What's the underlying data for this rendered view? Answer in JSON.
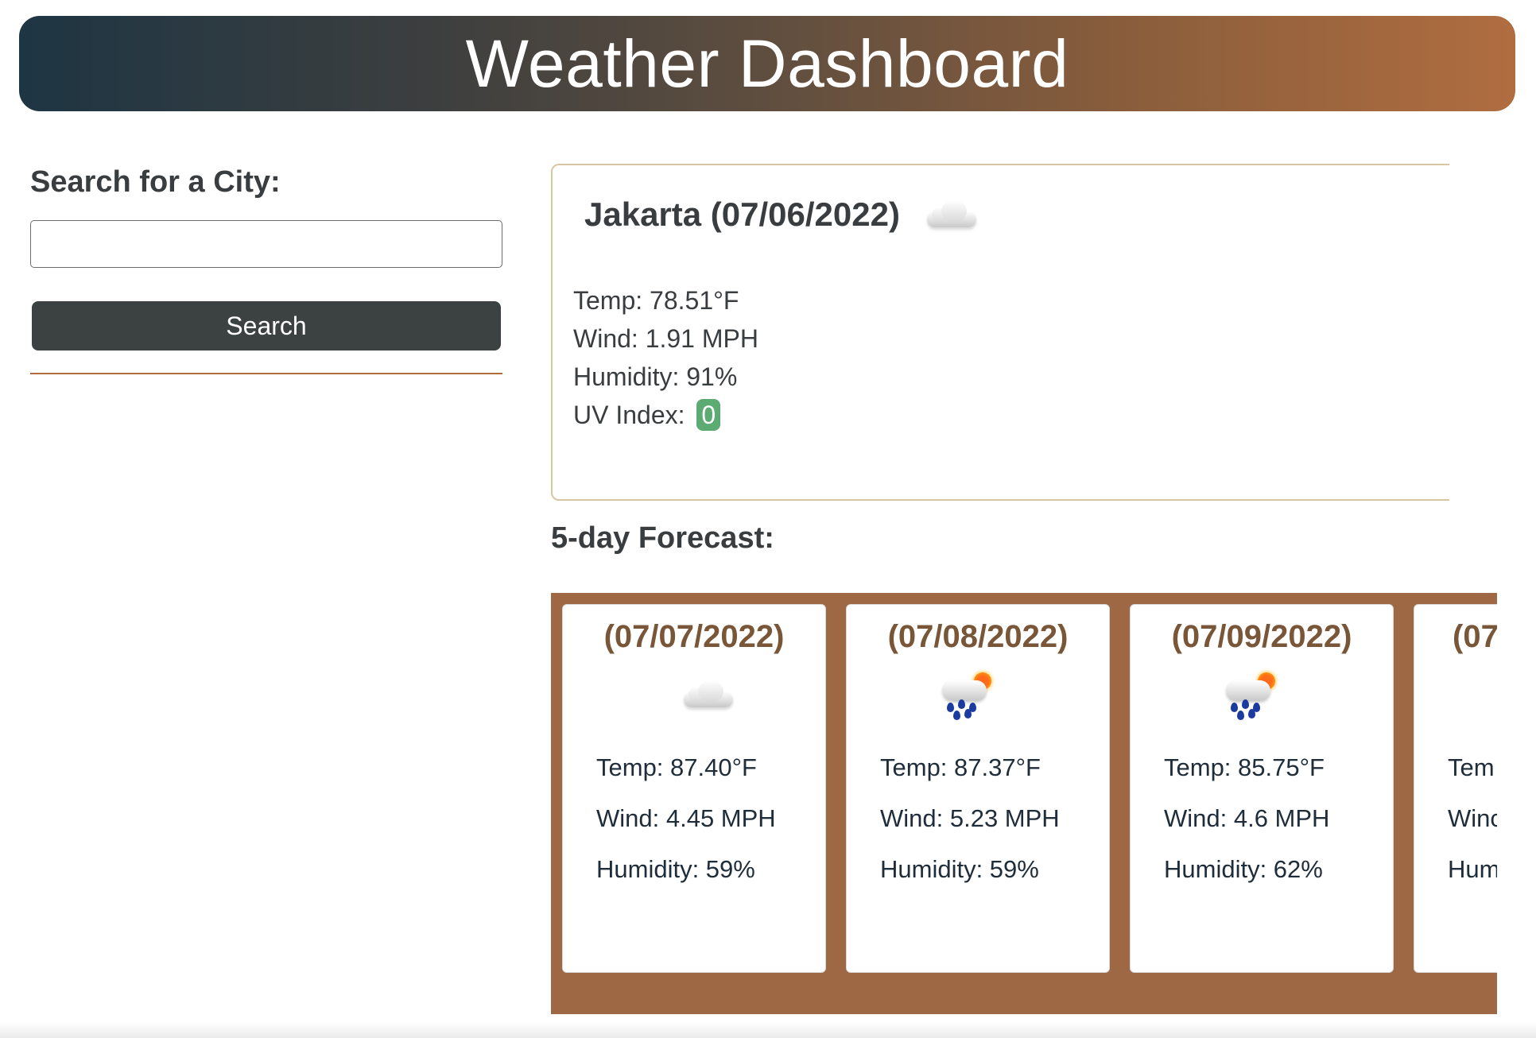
{
  "header": {
    "title": "Weather Dashboard"
  },
  "sidebar": {
    "search_label": "Search for a City:",
    "search_value": "",
    "search_placeholder": "",
    "search_button_label": "Search"
  },
  "current": {
    "title": "Jakarta (07/06/2022)",
    "icon": "cloud-icon",
    "temp": "Temp: 78.51°F",
    "wind": "Wind: 1.91 MPH",
    "humidity": "Humidity: 91%",
    "uv_label": "UV Index: ",
    "uv_value": "0",
    "uv_color": "#5cab73"
  },
  "forecast": {
    "heading": "5-day Forecast:",
    "strip_color": "#9d6843",
    "days": [
      {
        "date": "(07/07/2022)",
        "icon": "cloud-icon",
        "temp": "Temp: 87.40°F",
        "wind": "Wind: 4.45 MPH",
        "humidity": "Humidity: 59%"
      },
      {
        "date": "(07/08/2022)",
        "icon": "rain-sun-icon",
        "temp": "Temp: 87.37°F",
        "wind": "Wind: 5.23 MPH",
        "humidity": "Humidity: 59%"
      },
      {
        "date": "(07/09/2022)",
        "icon": "rain-sun-icon",
        "temp": "Temp: 85.75°F",
        "wind": "Wind: 4.6 MPH",
        "humidity": "Humidity: 62%"
      },
      {
        "date": "(07",
        "icon": "",
        "temp": "Tem",
        "wind": "Winc",
        "humidity": "Hum"
      }
    ]
  }
}
